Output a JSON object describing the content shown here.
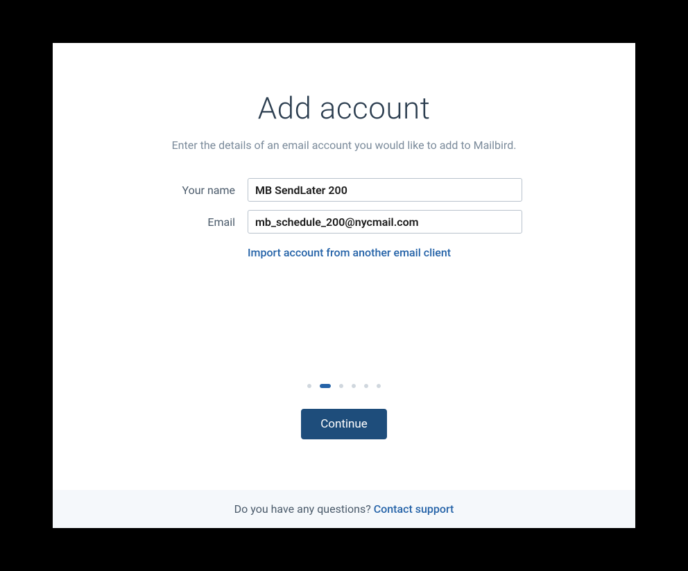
{
  "header": {
    "title": "Add account",
    "subtitle": "Enter the details of an email account you would like to add to Mailbird."
  },
  "form": {
    "name_label": "Your name",
    "name_value": "MB SendLater 200",
    "email_label": "Email",
    "email_value": "mb_schedule_200@nycmail.com",
    "import_link": "Import account from another email client"
  },
  "progress": {
    "total_steps": 6,
    "current_step": 2
  },
  "actions": {
    "continue_label": "Continue"
  },
  "footer": {
    "question_text": "Do you have any questions? ",
    "support_link": "Contact support"
  }
}
